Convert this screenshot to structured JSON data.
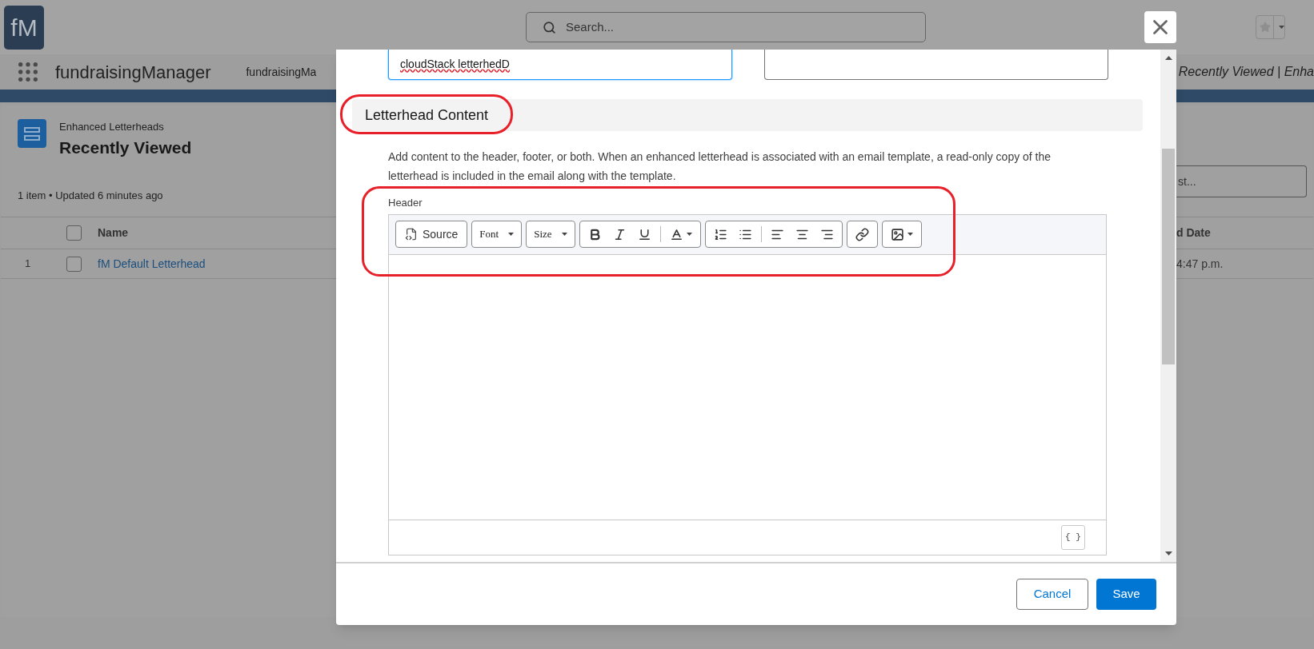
{
  "app": {
    "logo": "fM",
    "search": {
      "placeholder": "Search..."
    },
    "app_name": "fundraisingManager",
    "nav_tab": "fundraisingMa",
    "breadcrumb": "Recently Viewed | Enha"
  },
  "list_view": {
    "object": "Enhanced Letterheads",
    "title": "Recently Viewed",
    "summary": "1 item • Updated 6 minutes ago",
    "search": {
      "placeholder": "st..."
    },
    "select_all_checked": false,
    "columns": [
      "Name",
      "d Date"
    ],
    "rows": [
      {
        "number": "1",
        "name": "fM Default Letterhead",
        "date": "4:47 p.m.",
        "checked": false
      }
    ]
  },
  "modal": {
    "fields": [
      {
        "value": "cloudStack letterhedD",
        "focused": true
      },
      {
        "focused": false
      }
    ],
    "section": "Letterhead Content",
    "description": "Add content to the header, footer, or both. When an enhanced letterhead is associated with an email template, a read-only copy of the letterhead is included in the email along with the template.",
    "editor": {
      "label": "Header",
      "toolbar": [
        [
          {
            "kind": "source",
            "label": "Source"
          }
        ],
        [
          {
            "kind": "dropdown",
            "label": "Font"
          }
        ],
        [
          {
            "kind": "dropdown",
            "label": "Size"
          }
        ],
        [
          {
            "kind": "bold"
          },
          {
            "kind": "italic"
          },
          {
            "kind": "underline"
          },
          {
            "kind": "separator"
          },
          {
            "kind": "text-color"
          }
        ],
        [
          {
            "kind": "numbered-list"
          },
          {
            "kind": "bulleted-list"
          },
          {
            "kind": "separator"
          },
          {
            "kind": "align-left"
          },
          {
            "kind": "align-center"
          },
          {
            "kind": "align-right"
          }
        ],
        [
          {
            "kind": "link"
          }
        ],
        [
          {
            "kind": "image"
          }
        ]
      ],
      "merge_button": "{ }"
    },
    "buttons": [
      {
        "label": "Cancel",
        "kind": "secondary"
      },
      {
        "label": "Save",
        "kind": "primary"
      }
    ]
  }
}
